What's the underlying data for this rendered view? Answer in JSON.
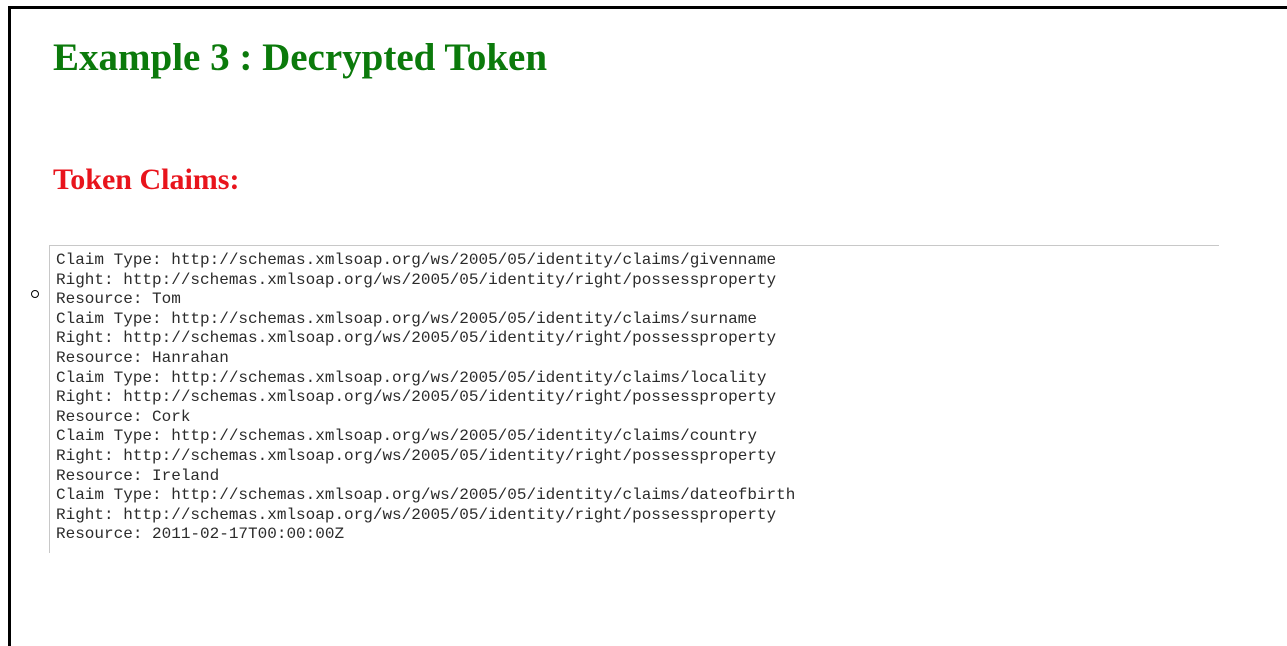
{
  "title": {
    "text": "Example 3 : Decrypted Token",
    "color": "#0b7a0b"
  },
  "subtitle": {
    "text": "Token Claims:",
    "color": "#e8141c"
  },
  "claims": [
    {
      "type": "Claim Type: http://schemas.xmlsoap.org/ws/2005/05/identity/claims/givenname",
      "right": "Right: http://schemas.xmlsoap.org/ws/2005/05/identity/right/possessproperty",
      "resource": "Resource: Tom"
    },
    {
      "type": "Claim Type: http://schemas.xmlsoap.org/ws/2005/05/identity/claims/surname",
      "right": "Right: http://schemas.xmlsoap.org/ws/2005/05/identity/right/possessproperty",
      "resource": "Resource: Hanrahan"
    },
    {
      "type": "Claim Type: http://schemas.xmlsoap.org/ws/2005/05/identity/claims/locality",
      "right": "Right: http://schemas.xmlsoap.org/ws/2005/05/identity/right/possessproperty",
      "resource": "Resource: Cork"
    },
    {
      "type": "Claim Type: http://schemas.xmlsoap.org/ws/2005/05/identity/claims/country",
      "right": "Right: http://schemas.xmlsoap.org/ws/2005/05/identity/right/possessproperty",
      "resource": "Resource: Ireland"
    },
    {
      "type": "Claim Type: http://schemas.xmlsoap.org/ws/2005/05/identity/claims/dateofbirth",
      "right": "Right: http://schemas.xmlsoap.org/ws/2005/05/identity/right/possessproperty",
      "resource": "Resource: 2011-02-17T00:00:00Z"
    }
  ]
}
